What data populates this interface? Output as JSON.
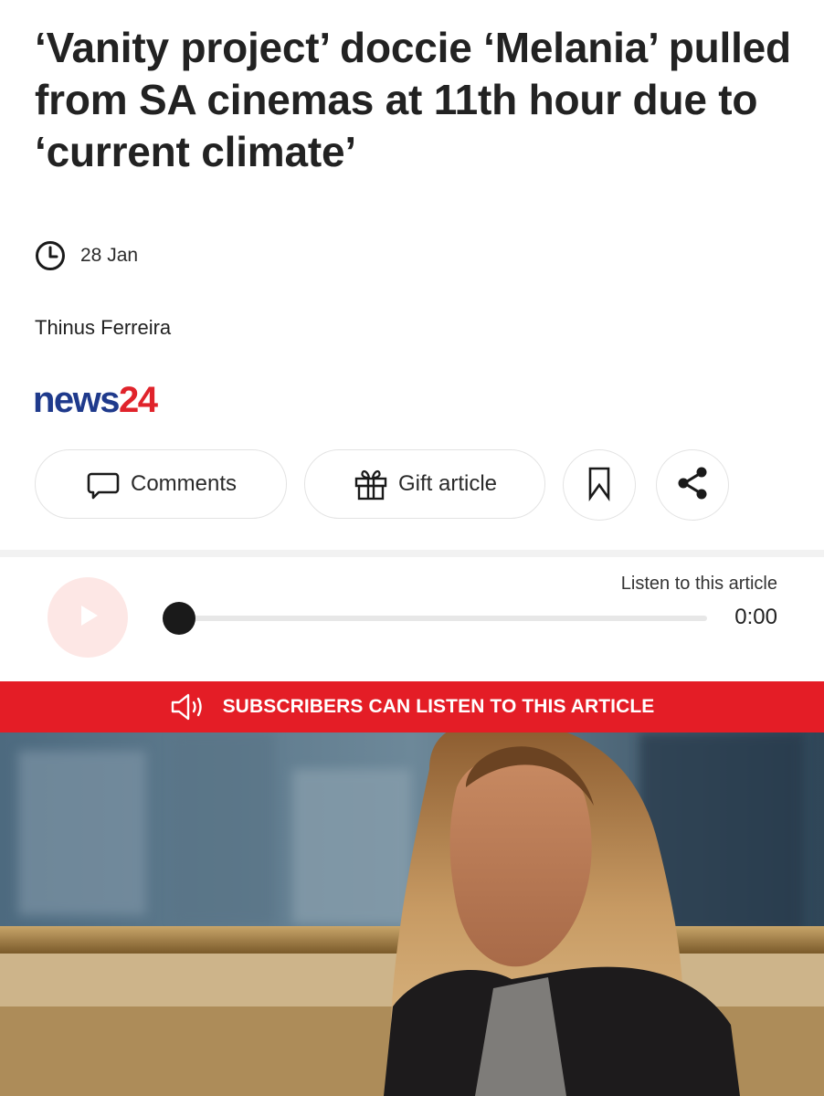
{
  "article": {
    "headline": "‘Vanity project’ doccie ‘Melania’ pulled from SA cinemas at 11th hour due to ‘current climate’",
    "date": "28 Jan",
    "author": "Thinus Ferreira"
  },
  "brand": {
    "part1": "news",
    "part2": "24",
    "colors": {
      "primary": "#1f3a8c",
      "accent": "#e0232b"
    }
  },
  "actions": {
    "comments_label": "Comments",
    "gift_label": "Gift article",
    "icons": [
      "comment-icon",
      "gift-icon",
      "bookmark-icon",
      "share-icon"
    ]
  },
  "player": {
    "listen_label": "Listen to this article",
    "time": "0:00",
    "progress": 0
  },
  "subscriber_banner": {
    "text": "SUBSCRIBERS CAN LISTEN TO THIS ARTICLE",
    "color": "#e41d26"
  }
}
